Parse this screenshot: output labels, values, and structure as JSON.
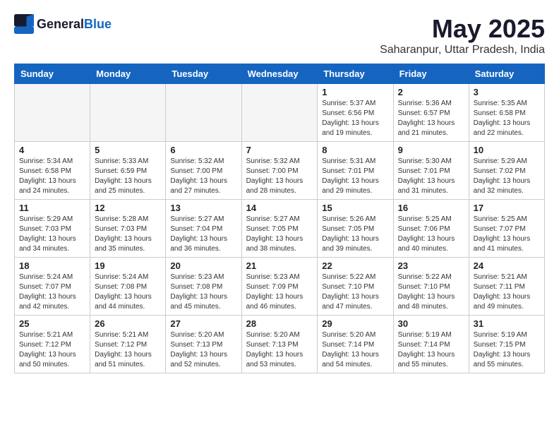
{
  "header": {
    "logo_general": "General",
    "logo_blue": "Blue",
    "title": "May 2025",
    "subtitle": "Saharanpur, Uttar Pradesh, India"
  },
  "weekdays": [
    "Sunday",
    "Monday",
    "Tuesday",
    "Wednesday",
    "Thursday",
    "Friday",
    "Saturday"
  ],
  "weeks": [
    [
      {
        "day": "",
        "info": ""
      },
      {
        "day": "",
        "info": ""
      },
      {
        "day": "",
        "info": ""
      },
      {
        "day": "",
        "info": ""
      },
      {
        "day": "1",
        "info": "Sunrise: 5:37 AM\nSunset: 6:56 PM\nDaylight: 13 hours\nand 19 minutes."
      },
      {
        "day": "2",
        "info": "Sunrise: 5:36 AM\nSunset: 6:57 PM\nDaylight: 13 hours\nand 21 minutes."
      },
      {
        "day": "3",
        "info": "Sunrise: 5:35 AM\nSunset: 6:58 PM\nDaylight: 13 hours\nand 22 minutes."
      }
    ],
    [
      {
        "day": "4",
        "info": "Sunrise: 5:34 AM\nSunset: 6:58 PM\nDaylight: 13 hours\nand 24 minutes."
      },
      {
        "day": "5",
        "info": "Sunrise: 5:33 AM\nSunset: 6:59 PM\nDaylight: 13 hours\nand 25 minutes."
      },
      {
        "day": "6",
        "info": "Sunrise: 5:32 AM\nSunset: 7:00 PM\nDaylight: 13 hours\nand 27 minutes."
      },
      {
        "day": "7",
        "info": "Sunrise: 5:32 AM\nSunset: 7:00 PM\nDaylight: 13 hours\nand 28 minutes."
      },
      {
        "day": "8",
        "info": "Sunrise: 5:31 AM\nSunset: 7:01 PM\nDaylight: 13 hours\nand 29 minutes."
      },
      {
        "day": "9",
        "info": "Sunrise: 5:30 AM\nSunset: 7:01 PM\nDaylight: 13 hours\nand 31 minutes."
      },
      {
        "day": "10",
        "info": "Sunrise: 5:29 AM\nSunset: 7:02 PM\nDaylight: 13 hours\nand 32 minutes."
      }
    ],
    [
      {
        "day": "11",
        "info": "Sunrise: 5:29 AM\nSunset: 7:03 PM\nDaylight: 13 hours\nand 34 minutes."
      },
      {
        "day": "12",
        "info": "Sunrise: 5:28 AM\nSunset: 7:03 PM\nDaylight: 13 hours\nand 35 minutes."
      },
      {
        "day": "13",
        "info": "Sunrise: 5:27 AM\nSunset: 7:04 PM\nDaylight: 13 hours\nand 36 minutes."
      },
      {
        "day": "14",
        "info": "Sunrise: 5:27 AM\nSunset: 7:05 PM\nDaylight: 13 hours\nand 38 minutes."
      },
      {
        "day": "15",
        "info": "Sunrise: 5:26 AM\nSunset: 7:05 PM\nDaylight: 13 hours\nand 39 minutes."
      },
      {
        "day": "16",
        "info": "Sunrise: 5:25 AM\nSunset: 7:06 PM\nDaylight: 13 hours\nand 40 minutes."
      },
      {
        "day": "17",
        "info": "Sunrise: 5:25 AM\nSunset: 7:07 PM\nDaylight: 13 hours\nand 41 minutes."
      }
    ],
    [
      {
        "day": "18",
        "info": "Sunrise: 5:24 AM\nSunset: 7:07 PM\nDaylight: 13 hours\nand 42 minutes."
      },
      {
        "day": "19",
        "info": "Sunrise: 5:24 AM\nSunset: 7:08 PM\nDaylight: 13 hours\nand 44 minutes."
      },
      {
        "day": "20",
        "info": "Sunrise: 5:23 AM\nSunset: 7:08 PM\nDaylight: 13 hours\nand 45 minutes."
      },
      {
        "day": "21",
        "info": "Sunrise: 5:23 AM\nSunset: 7:09 PM\nDaylight: 13 hours\nand 46 minutes."
      },
      {
        "day": "22",
        "info": "Sunrise: 5:22 AM\nSunset: 7:10 PM\nDaylight: 13 hours\nand 47 minutes."
      },
      {
        "day": "23",
        "info": "Sunrise: 5:22 AM\nSunset: 7:10 PM\nDaylight: 13 hours\nand 48 minutes."
      },
      {
        "day": "24",
        "info": "Sunrise: 5:21 AM\nSunset: 7:11 PM\nDaylight: 13 hours\nand 49 minutes."
      }
    ],
    [
      {
        "day": "25",
        "info": "Sunrise: 5:21 AM\nSunset: 7:12 PM\nDaylight: 13 hours\nand 50 minutes."
      },
      {
        "day": "26",
        "info": "Sunrise: 5:21 AM\nSunset: 7:12 PM\nDaylight: 13 hours\nand 51 minutes."
      },
      {
        "day": "27",
        "info": "Sunrise: 5:20 AM\nSunset: 7:13 PM\nDaylight: 13 hours\nand 52 minutes."
      },
      {
        "day": "28",
        "info": "Sunrise: 5:20 AM\nSunset: 7:13 PM\nDaylight: 13 hours\nand 53 minutes."
      },
      {
        "day": "29",
        "info": "Sunrise: 5:20 AM\nSunset: 7:14 PM\nDaylight: 13 hours\nand 54 minutes."
      },
      {
        "day": "30",
        "info": "Sunrise: 5:19 AM\nSunset: 7:14 PM\nDaylight: 13 hours\nand 55 minutes."
      },
      {
        "day": "31",
        "info": "Sunrise: 5:19 AM\nSunset: 7:15 PM\nDaylight: 13 hours\nand 55 minutes."
      }
    ]
  ]
}
